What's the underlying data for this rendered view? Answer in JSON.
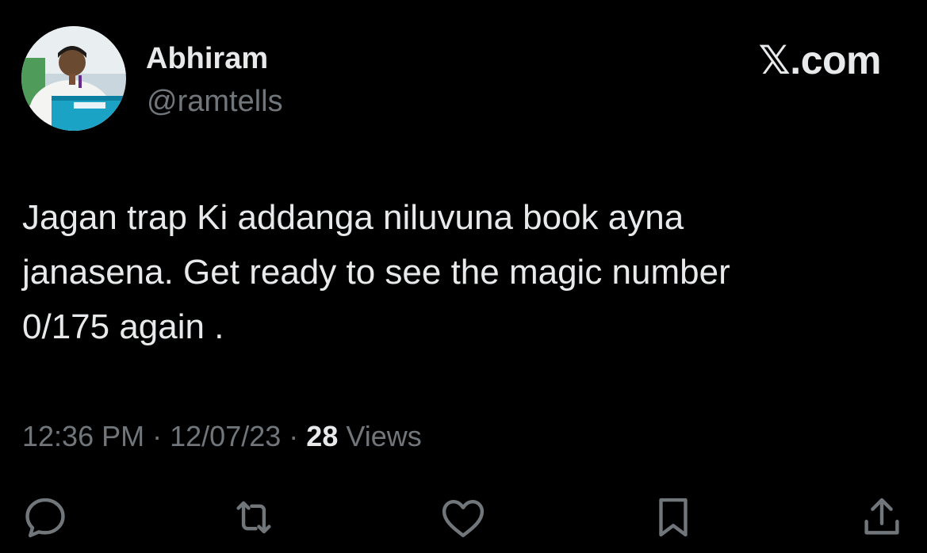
{
  "author": {
    "display_name": "Abhiram",
    "handle": "@ramtells",
    "avatar": "profile-photo"
  },
  "brand": {
    "label": "𝕏.com"
  },
  "tweet": {
    "text": "Jagan trap Ki addanga niluvuna book ayna\njanasena. Get ready to see the magic number\n0/175 again ."
  },
  "meta": {
    "time": "12:36 PM",
    "separator": "·",
    "date": "12/07/23",
    "views_count": "28",
    "views_label": "Views"
  },
  "actions": [
    {
      "name": "reply",
      "icon": "reply-icon"
    },
    {
      "name": "retweet",
      "icon": "retweet-icon"
    },
    {
      "name": "like",
      "icon": "heart-icon"
    },
    {
      "name": "bookmark",
      "icon": "bookmark-icon"
    },
    {
      "name": "share",
      "icon": "share-icon"
    }
  ],
  "colors": {
    "background": "#000000",
    "primary_text": "#e7e9ea",
    "secondary_text": "#71767b"
  }
}
